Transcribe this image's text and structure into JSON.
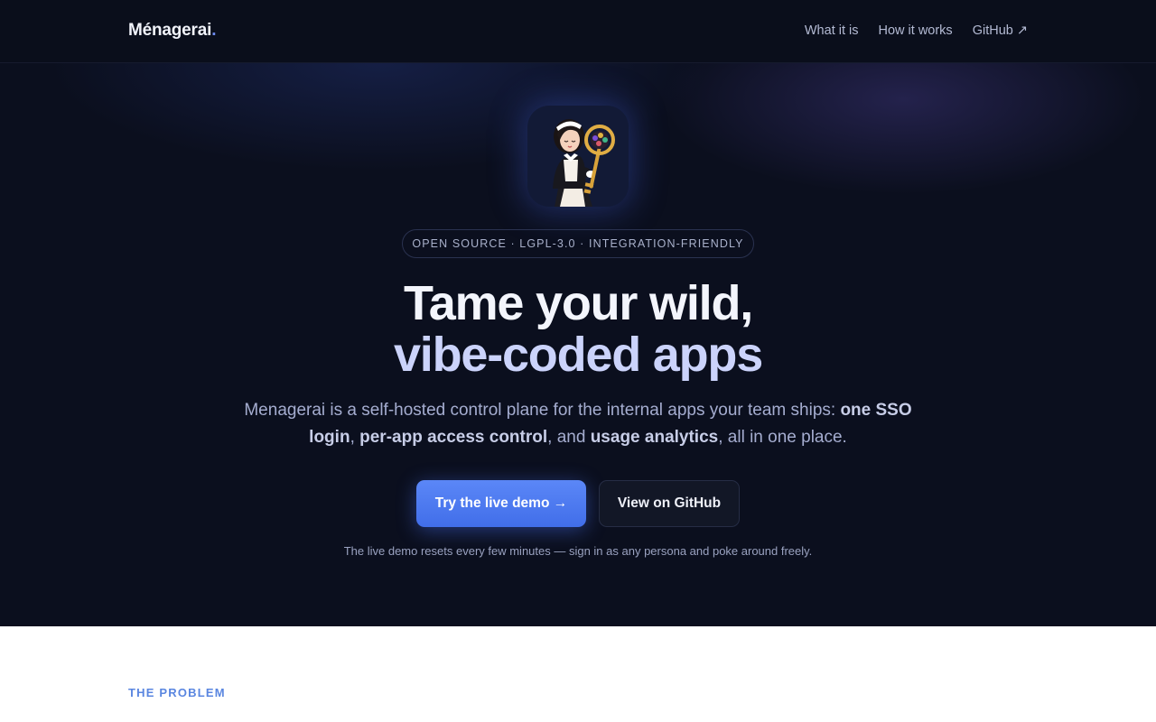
{
  "nav": {
    "brand": "Ménagerai",
    "brand_dot": ".",
    "links": [
      "What it is",
      "How it works",
      "GitHub ↗"
    ]
  },
  "hero": {
    "badge": "OPEN SOURCE · LGPL-3.0 · INTEGRATION-FRIENDLY",
    "title_line1": "Tame your wild,",
    "title_line2": "vibe-coded apps",
    "lead": {
      "part1": "Menagerai is a self-hosted control plane for the internal apps your team ships: ",
      "bold1": "one SSO login",
      "sep1": ", ",
      "bold2": "per-app access control",
      "sep2": ", and ",
      "bold3": "usage analytics",
      "part2": ", all in one place."
    },
    "primary_cta": "Try the live demo →",
    "secondary_cta": "View on GitHub",
    "note": "The live demo resets every few minutes — sign in as any persona and poke around freely."
  },
  "problem": {
    "eyebrow": "THE PROBLEM"
  },
  "colors": {
    "accent": "#5b87f7",
    "background": "#0b0f1e",
    "eyebrow": "#5a86e0"
  },
  "icons": {
    "logo": "maid-holding-key-logo-icon"
  }
}
